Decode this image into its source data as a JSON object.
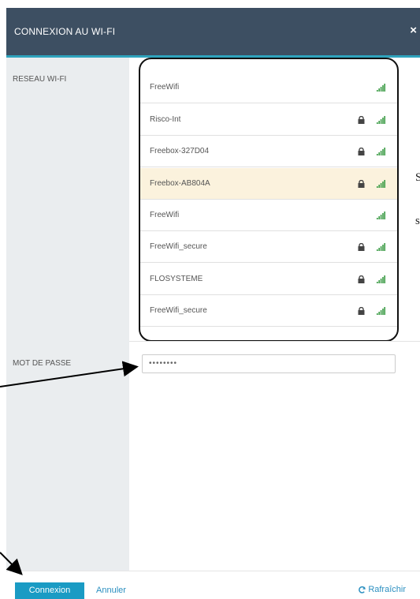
{
  "header": {
    "title": "CONNEXION AU WI-FI",
    "close_label": "×"
  },
  "labels": {
    "wifi_network": "RESEAU WI-FI",
    "password": "MOT DE PASSE"
  },
  "networks": [
    {
      "name": "FreeWifi",
      "locked": false,
      "selected": false,
      "signal_icon": "signal-bars-icon"
    },
    {
      "name": "Risco-Int",
      "locked": true,
      "selected": false,
      "signal_icon": "signal-bars-icon"
    },
    {
      "name": "Freebox-327D04",
      "locked": true,
      "selected": false,
      "signal_icon": "signal-bars-icon"
    },
    {
      "name": "Freebox-AB804A",
      "locked": true,
      "selected": true,
      "signal_icon": "signal-bars-icon"
    },
    {
      "name": "FreeWifi",
      "locked": false,
      "selected": false,
      "signal_icon": "signal-bars-icon"
    },
    {
      "name": "FreeWifi_secure",
      "locked": true,
      "selected": false,
      "signal_icon": "signal-bars-icon"
    },
    {
      "name": "FLOSYSTEME",
      "locked": true,
      "selected": false,
      "signal_icon": "signal-bars-icon"
    },
    {
      "name": "FreeWifi_secure",
      "locked": true,
      "selected": false,
      "signal_icon": "signal-bars-icon"
    }
  ],
  "password": {
    "value": "••••••••"
  },
  "footer": {
    "connect_label": "Connexion",
    "cancel_label": "Annuler",
    "refresh_label": "Rafraîchir",
    "refresh_icon": "refresh-icon"
  },
  "side_text": [
    "S",
    "s"
  ],
  "colors": {
    "header_bg": "#3d4f62",
    "accent": "#2fa3bd",
    "sidebar_bg": "#eaedef",
    "selected_row": "#fbf2dd",
    "button_bg": "#1a9bc4",
    "link": "#2b8fc0"
  }
}
